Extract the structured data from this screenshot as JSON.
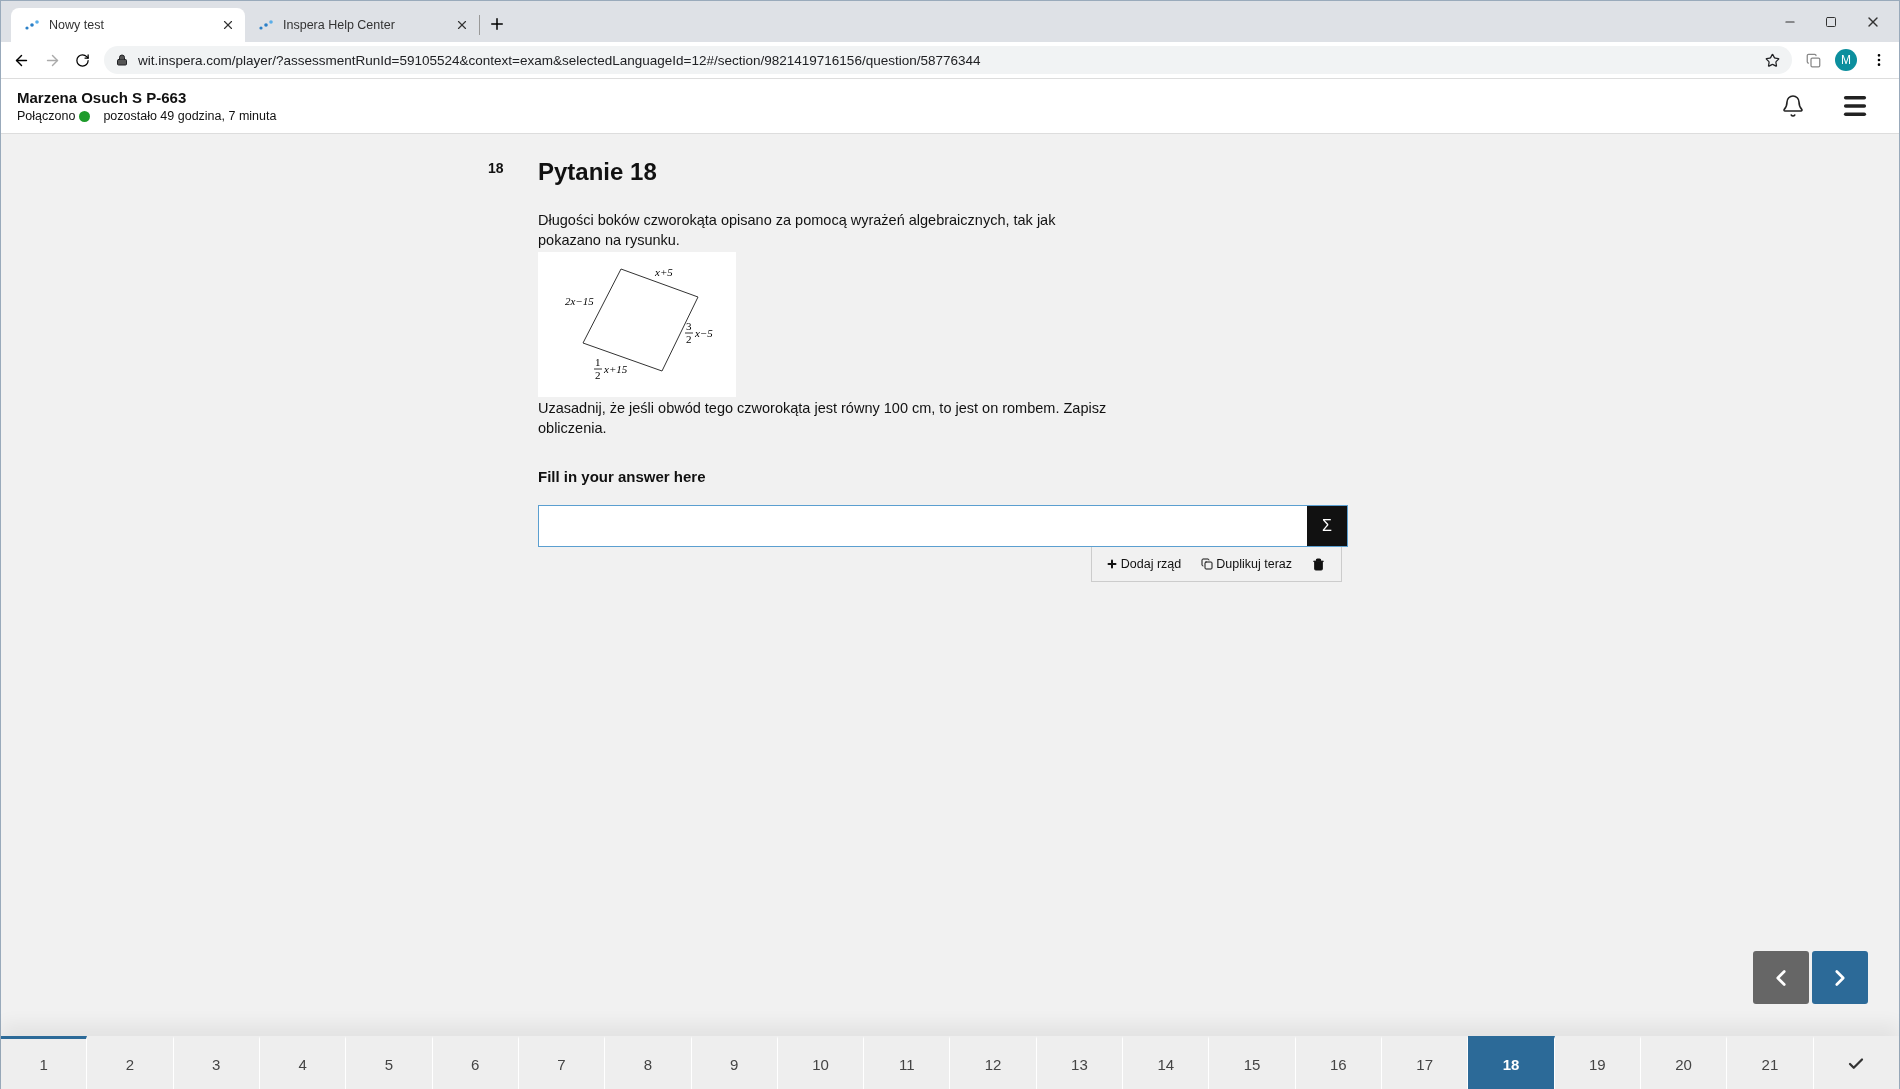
{
  "browser": {
    "tabs": [
      {
        "title": "Nowy test",
        "selected": true
      },
      {
        "title": "Inspera Help Center",
        "selected": false
      }
    ],
    "address": "wit.inspera.com/player/?assessmentRunId=59105524&context=exam&selectedLanguageId=12#/section/9821419716156/question/58776344",
    "profile_initial": "M"
  },
  "header": {
    "candidate": "Marzena Osuch S P-663",
    "status": "Połączono",
    "connected": true,
    "time_left": "pozostało 49 godzina, 7 minuta"
  },
  "question": {
    "number": "18",
    "title": "Pytanie 18",
    "intro": "Długości boków czworokąta opisano za pomocą wyrażeń algebraicznych, tak jak pokazano na rysunku.",
    "figure_labels": [
      {
        "kind": "plain",
        "text": "x+5"
      },
      {
        "kind": "plain",
        "text": "2x−15"
      },
      {
        "kind": "fraction",
        "numerator": "3",
        "denominator": "2",
        "text": "x−5"
      },
      {
        "kind": "fraction",
        "numerator": "1",
        "denominator": "2",
        "text": "x+15"
      }
    ],
    "task": "Uzasadnij, że jeśli obwód tego czworokąta jest równy 100 cm, to jest on rombem. Zapisz obliczenia.",
    "answer_label": "Fill in your answer here",
    "math_button": "Σ",
    "actions": [
      {
        "kind": "add",
        "label": "Dodaj rząd"
      },
      {
        "kind": "duplicate",
        "label": "Duplikuj teraz"
      },
      {
        "kind": "delete"
      }
    ]
  },
  "nav": {
    "questions": [
      {
        "label": "1",
        "selected": false,
        "visited": true
      },
      {
        "label": "2",
        "selected": false,
        "visited": false
      },
      {
        "label": "3",
        "selected": false,
        "visited": false
      },
      {
        "label": "4",
        "selected": false,
        "visited": false
      },
      {
        "label": "5",
        "selected": false,
        "visited": false
      },
      {
        "label": "6",
        "selected": false,
        "visited": false
      },
      {
        "label": "7",
        "selected": false,
        "visited": false
      },
      {
        "label": "8",
        "selected": false,
        "visited": false
      },
      {
        "label": "9",
        "selected": false,
        "visited": false
      },
      {
        "label": "10",
        "selected": false,
        "visited": false
      },
      {
        "label": "11",
        "selected": false,
        "visited": false
      },
      {
        "label": "12",
        "selected": false,
        "visited": false
      },
      {
        "label": "13",
        "selected": false,
        "visited": false
      },
      {
        "label": "14",
        "selected": false,
        "visited": false
      },
      {
        "label": "15",
        "selected": false,
        "visited": false
      },
      {
        "label": "16",
        "selected": false,
        "visited": false
      },
      {
        "label": "17",
        "selected": false,
        "visited": false
      },
      {
        "label": "18",
        "selected": true,
        "visited": true
      },
      {
        "label": "19",
        "selected": false,
        "visited": false
      },
      {
        "label": "20",
        "selected": false,
        "visited": false
      },
      {
        "label": "21",
        "selected": false,
        "visited": false
      }
    ]
  }
}
